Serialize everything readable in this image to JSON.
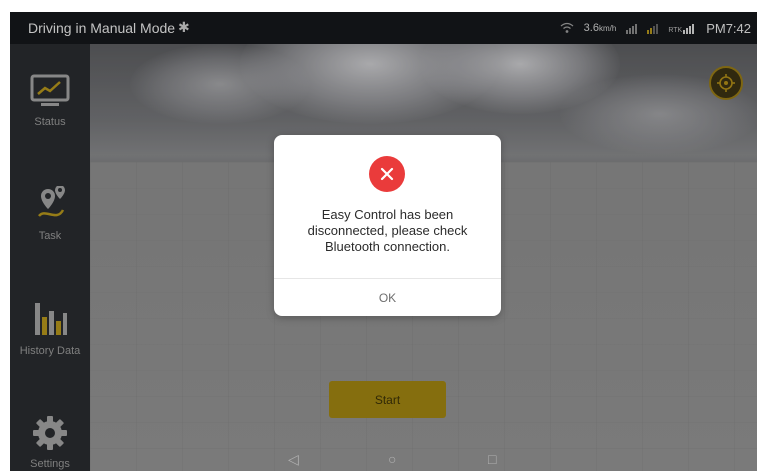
{
  "status_bar": {
    "title": "Driving in Manual Mode",
    "bluetooth_icon": "bluetooth-icon",
    "speed": "3.6",
    "speed_unit": "km/h",
    "rtk_label": "RTK",
    "time": "PM7:42"
  },
  "sidebar": {
    "items": [
      {
        "label": "Status",
        "icon": "monitor-chart-icon"
      },
      {
        "label": "Task",
        "icon": "route-pin-icon"
      },
      {
        "label": "History Data",
        "icon": "bar-chart-icon"
      },
      {
        "label": "Settings",
        "icon": "gear-icon"
      }
    ]
  },
  "main": {
    "start_label": "Start",
    "locate_icon": "crosshair-icon"
  },
  "dialog": {
    "icon": "error-x-icon",
    "message": "Easy Control has been disconnected, please check Bluetooth connection.",
    "ok_label": "OK"
  },
  "navbar": {
    "back_icon": "back-triangle-icon",
    "home_icon": "home-circle-icon",
    "recents_icon": "recents-square-icon"
  },
  "colors": {
    "accent": "#a38712",
    "error": "#ea3b3b",
    "sidebar_bg": "#2a2d30",
    "status_bg": "#15181b"
  }
}
